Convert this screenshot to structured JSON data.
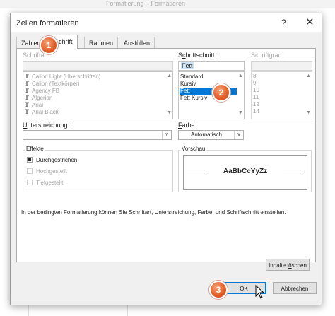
{
  "background": {
    "title_text": "Formatierung – Formatieren"
  },
  "dialog": {
    "title": "Zellen formatieren",
    "help": "?",
    "close": "✕",
    "tabs": [
      "Zahlen",
      "Schrift",
      "Rahmen",
      "Ausfüllen"
    ],
    "active_tab": "Schrift"
  },
  "schriftart": {
    "label": "Schriftart:",
    "value": "",
    "items": [
      "Calibri Light (Überschriften)",
      "Calibri (Textkörper)",
      "Agency FB",
      "Algerian",
      "Arial",
      "Arial Black"
    ],
    "icon": "truetype-icon"
  },
  "schriftschnitt": {
    "label_prefix": "S",
    "label_underline": "c",
    "label_rest": "hriftschnitt:",
    "value": "Fett",
    "items": [
      "Standard",
      "Kursiv",
      "Fett",
      "Fett Kursiv"
    ],
    "selected": "Fett"
  },
  "schriftgrad": {
    "label": "Schriftgrad:",
    "items": [
      "8",
      "9",
      "10",
      "11",
      "12",
      "14"
    ]
  },
  "unterstreichung": {
    "label_underline": "U",
    "label_rest": "nterstreichung:",
    "value": ""
  },
  "farbe": {
    "label_underline": "F",
    "label_rest": "arbe:",
    "value": "Automatisch"
  },
  "effekte": {
    "title": "Effekte",
    "durchgestrichen_underline": "D",
    "durchgestrichen_rest": "urchgestrichen",
    "hochgestellt": "Hochgestellt",
    "tiefgestellt": "Tiefgestellt",
    "durchgestrichen_state": "indeterminate"
  },
  "vorschau": {
    "title": "Vorschau",
    "sample": "AaBbCcYyZz"
  },
  "info_text": "In der bedingten Formatierung können Sie Schriftart, Unterstreichung, Farbe, und Schriftschnitt einstellen.",
  "buttons": {
    "inhalte_prefix": "Inhalte l",
    "inhalte_underline": "ö",
    "inhalte_rest": "schen",
    "ok": "OK",
    "abbrechen": "Abbrechen"
  },
  "badges": [
    "1",
    "2",
    "3"
  ],
  "colors": {
    "accent": "#0078d7",
    "badge": "#e35a22"
  }
}
